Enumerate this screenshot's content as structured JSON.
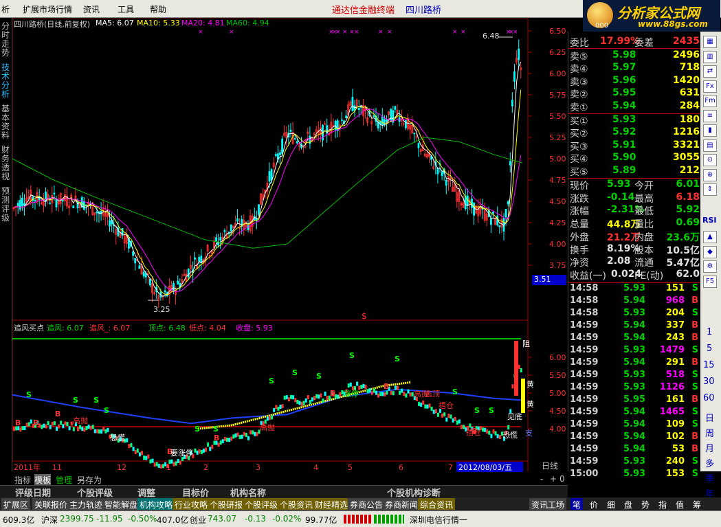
{
  "menu": {
    "items": [
      "析",
      "扩展市场行情",
      "资讯",
      "工具",
      "帮助"
    ],
    "title_app": "通达信金融终端",
    "title_stock": "四川路桥"
  },
  "logo": {
    "text": "分析家公式网",
    "url": "www.88gs.com",
    "badge": "000"
  },
  "left_tabs": [
    "分时走势",
    "技术分析",
    "基本资料",
    "财务透视",
    "预测评级"
  ],
  "main_chart": {
    "header": {
      "title": "四川路桥(日线,前复权)",
      "ma5": "MA5: 6.07",
      "ma10": "MA10: 5.33",
      "ma20": "MA20: 4.81",
      "ma60": "MA60: 4.94"
    },
    "y_ticks": [
      "6.50",
      "6.25",
      "6.00",
      "5.75",
      "5.50",
      "5.25",
      "5.00",
      "4.75",
      "4.50",
      "4.25",
      "4.00",
      "3.75"
    ],
    "high_label": "6.48",
    "low_label": "3.25",
    "price_box": "3.51",
    "colors": {
      "ma5": "#ffffff",
      "ma10": "#ffff00",
      "ma20": "#ff00ff",
      "ma60": "#00c000",
      "up": "#ff3030",
      "down": "#00ffff"
    }
  },
  "sub_chart": {
    "header": {
      "name": "追风买点",
      "zf": "追风: 6.07",
      "zf2": "追风_: 6.07",
      "top": "顶点: 6.48",
      "bottom": "低点: 4.04",
      "close": "收盘: 5.93"
    },
    "y_ticks": [
      "6.00",
      "5.50",
      "5.00",
      "4.50",
      "4.00"
    ],
    "annotations": [
      "阻",
      "黄",
      "黄",
      "支",
      "恐慌",
      "要涨停",
      "恐慌",
      "高抛",
      "涨停",
      "高抛",
      "逃顶",
      "捂仓",
      "捂仓",
      "高抛",
      "见底",
      "S",
      "B"
    ]
  },
  "x_axis": {
    "labels": [
      "2011年",
      "11",
      "12",
      "1",
      "2",
      "3",
      "4",
      "5",
      "6",
      "7"
    ],
    "date_box": "2012/08/03/五",
    "period": "日线"
  },
  "chart_controls": {
    "left": [
      "指标",
      "模板",
      "管理",
      "另存为"
    ],
    "right": [
      "-",
      "+",
      "0"
    ]
  },
  "order_book": {
    "wei_bi": {
      "label": "委比",
      "pct": "17.99%",
      "diff_label": "委差",
      "diff": "2435"
    },
    "asks": [
      {
        "label": "卖⑤",
        "price": "5.98",
        "vol": "2496"
      },
      {
        "label": "卖④",
        "price": "5.97",
        "vol": "718"
      },
      {
        "label": "卖③",
        "price": "5.96",
        "vol": "1420"
      },
      {
        "label": "卖②",
        "price": "5.95",
        "vol": "631"
      },
      {
        "label": "卖①",
        "price": "5.94",
        "vol": "284"
      }
    ],
    "bids": [
      {
        "label": "买①",
        "price": "5.93",
        "vol": "180"
      },
      {
        "label": "买②",
        "price": "5.92",
        "vol": "1216"
      },
      {
        "label": "买③",
        "price": "5.91",
        "vol": "3321"
      },
      {
        "label": "买④",
        "price": "5.90",
        "vol": "3055"
      },
      {
        "label": "买⑤",
        "price": "5.89",
        "vol": "212"
      }
    ],
    "stats": [
      {
        "l1": "现价",
        "v1": "5.93",
        "c1": "#00d000",
        "l2": "今开",
        "v2": "6.01",
        "c2": "#00d000"
      },
      {
        "l1": "涨跌",
        "v1": "-0.14",
        "c1": "#00d000",
        "l2": "最高",
        "v2": "6.18",
        "c2": "#ff3030"
      },
      {
        "l1": "涨幅",
        "v1": "-2.31%",
        "c1": "#00d000",
        "l2": "最低",
        "v2": "5.92",
        "c2": "#00d000"
      },
      {
        "l1": "总量",
        "v1": "44.8万",
        "c1": "#ffff00",
        "l2": "量比",
        "v2": "0.69",
        "c2": "#00d000"
      },
      {
        "l1": "外盘",
        "v1": "21.2万",
        "c1": "#ff3030",
        "l2": "内盘",
        "v2": "23.6万",
        "c2": "#00d000"
      },
      {
        "l1": "换手",
        "v1": "8.19%",
        "c1": "#e0e0e0",
        "l2": "股本",
        "v2": "10.5亿",
        "c2": "#e0e0e0"
      },
      {
        "l1": "净资",
        "v1": "2.08",
        "c1": "#e0e0e0",
        "l2": "流通",
        "v2": "5.47亿",
        "c2": "#e0e0e0"
      },
      {
        "l1": "收益(一)",
        "v1": "0.024",
        "c1": "#e0e0e0",
        "l2": "PE(动)",
        "v2": "62.0",
        "c2": "#e0e0e0"
      }
    ]
  },
  "ticks": [
    {
      "time": "14:58",
      "price": "5.93",
      "vol": "151",
      "dir": "S",
      "vc": "#ffff00"
    },
    {
      "time": "14:58",
      "price": "5.94",
      "vol": "968",
      "dir": "B",
      "vc": "#ff00ff"
    },
    {
      "time": "14:58",
      "price": "5.93",
      "vol": "204",
      "dir": "S",
      "vc": "#ffff00"
    },
    {
      "time": "14:59",
      "price": "5.94",
      "vol": "337",
      "dir": "B",
      "vc": "#ffff00"
    },
    {
      "time": "14:59",
      "price": "5.94",
      "vol": "243",
      "dir": "B",
      "vc": "#ffff00"
    },
    {
      "time": "14:59",
      "price": "5.93",
      "vol": "1479",
      "dir": "S",
      "vc": "#ff00ff"
    },
    {
      "time": "14:59",
      "price": "5.94",
      "vol": "291",
      "dir": "B",
      "vc": "#ffff00"
    },
    {
      "time": "14:59",
      "price": "5.93",
      "vol": "518",
      "dir": "S",
      "vc": "#ff00ff"
    },
    {
      "time": "14:59",
      "price": "5.93",
      "vol": "1126",
      "dir": "S",
      "vc": "#ff00ff"
    },
    {
      "time": "14:59",
      "price": "5.95",
      "vol": "161",
      "dir": "B",
      "vc": "#ffff00"
    },
    {
      "time": "14:59",
      "price": "5.94",
      "vol": "1465",
      "dir": "S",
      "vc": "#ff00ff"
    },
    {
      "time": "14:59",
      "price": "5.94",
      "vol": "109",
      "dir": "S",
      "vc": "#ffff00"
    },
    {
      "time": "14:59",
      "price": "5.94",
      "vol": "102",
      "dir": "B",
      "vc": "#ffff00"
    },
    {
      "time": "14:59",
      "price": "5.94",
      "vol": "53",
      "dir": "B",
      "vc": "#ffff00"
    },
    {
      "time": "14:59",
      "price": "5.93",
      "vol": "240",
      "dir": "S",
      "vc": "#ffff00"
    },
    {
      "time": "15:00",
      "price": "5.93",
      "vol": "153",
      "dir": "S",
      "vc": "#ffff00"
    }
  ],
  "icon_strip": {
    "buttons": [
      "RSI"
    ],
    "numbers": [
      "1",
      "5",
      "15",
      "30",
      "60"
    ],
    "periods": [
      "日",
      "周",
      "月",
      "多",
      "季",
      "年"
    ]
  },
  "bottom_bar1": [
    "评级日期",
    "个股评级",
    "调整",
    "目标价",
    "机构名称",
    "个股机构诊断"
  ],
  "bottom_bar2": [
    {
      "label": "扩展区",
      "bg": "#404040"
    },
    {
      "label": "关联报价",
      "bg": "#404040"
    },
    {
      "label": "主力轨迹",
      "bg": "#404040"
    },
    {
      "label": "智能解盘",
      "bg": "#404040"
    },
    {
      "label": "机构攻略",
      "bg": "#007070"
    },
    {
      "label": "行业攻略",
      "bg": "#706000"
    },
    {
      "label": "个股研报",
      "bg": "#706000"
    },
    {
      "label": "个股评级",
      "bg": "#706000"
    },
    {
      "label": "个股资讯",
      "bg": "#706000"
    },
    {
      "label": "财经精选",
      "bg": "#706000"
    },
    {
      "label": "券商公告",
      "bg": "#404040"
    },
    {
      "label": "券商新闻",
      "bg": "#404040"
    },
    {
      "label": "综合资讯",
      "bg": "#706000"
    },
    {
      "label": "资讯工场",
      "bg": "#404040"
    }
  ],
  "bottom_tools": [
    "笔",
    "价",
    "细",
    "盘",
    "势",
    "指",
    "值",
    "筹"
  ],
  "status_bar": {
    "sh_amount": "609.3亿",
    "sz_label": "沪深",
    "sz_index": "2399.75",
    "sz_change": "-11.95",
    "sz_pct": "-0.50%",
    "sz_amount": "407.0亿",
    "cy_label": "创业",
    "cy_index": "743.07",
    "cy_change": "-0.13",
    "cy_pct": "-0.02%",
    "cy_amount": "99.77亿",
    "news": "深圳电信行情一"
  }
}
